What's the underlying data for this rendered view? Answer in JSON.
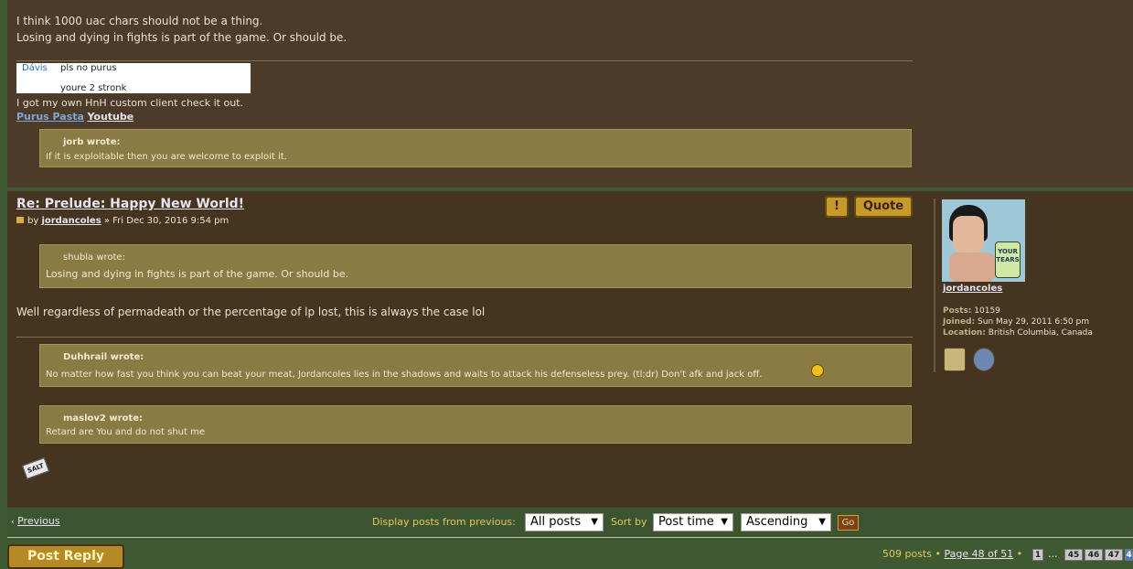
{
  "post1": {
    "lines": [
      "I think 1000 uac chars should not be a thing.",
      "Losing and dying in fights is part of the game. Or should be."
    ],
    "chat": {
      "name": "Dávis",
      "line1": "pls no purus",
      "line2": "youre 2 stronk"
    },
    "sig_text": "I got my own HnH custom client check it out.",
    "sig_link1": "Purus Pasta",
    "sig_link2": "Youtube",
    "quote": {
      "author": "jorb wrote:",
      "text": "If it is exploitable then you are welcome to exploit it."
    }
  },
  "post2": {
    "title": "Re: Prelude: Happy New World!",
    "by": "by",
    "author": "jordancoles",
    "date": "» Fri Dec 30, 2016 9:54 pm",
    "report_label": "!",
    "quote_label": "Quote",
    "quote1": {
      "author": "shubla wrote:",
      "text": "Losing and dying in fights is part of the game. Or should be."
    },
    "body": "Well regardless of permadeath or the percentage of lp lost, this is always the case lol",
    "quote2": {
      "author": "Duhhrail wrote:",
      "text": "No matter how fast you think you can beat your meat, Jordancoles lies in the shadows and waits to attack his defenseless prey. (tl;dr) Don't afk and jack off."
    },
    "quote3": {
      "author": "maslov2 wrote:",
      "text": "Retard are You and do not shut me"
    },
    "salt_label": "SALT"
  },
  "profile": {
    "avatar_caption_top": "YOUR",
    "avatar_caption_bottom": "TEARS",
    "username": "jordancoles",
    "posts_label": "Posts:",
    "posts_value": "10159",
    "joined_label": "Joined:",
    "joined_value": "Sun May 29, 2011 6:50 pm",
    "location_label": "Location:",
    "location_value": "British Columbia, Canada"
  },
  "nav": {
    "previous": "Previous",
    "display_label": "Display posts from previous:",
    "display_value": "All posts",
    "sort_label": "Sort by",
    "sort_value": "Post time",
    "order_value": "Ascending",
    "go_label": "Go"
  },
  "footer": {
    "post_reply": "Post Reply",
    "post_count": "509 posts",
    "page_info": "Page 48 of 51",
    "pages": [
      "1",
      "...",
      "45",
      "46",
      "47",
      "4"
    ]
  },
  "colors": {
    "post_bg": "#45341f",
    "quote_bg": "#8a7a43",
    "link": "#e8e4f2",
    "accent_text": "#e0c85a"
  }
}
